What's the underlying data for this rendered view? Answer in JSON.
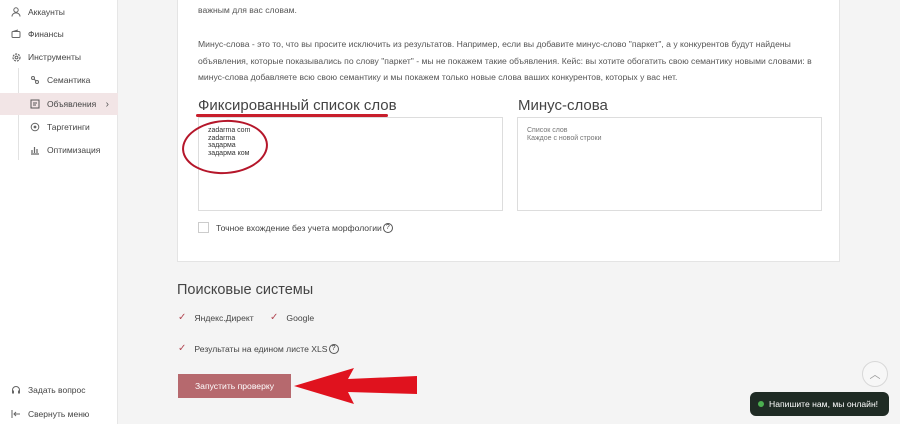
{
  "sidebar": {
    "items": [
      {
        "label": "Аккаунты",
        "icon": "user-icon"
      },
      {
        "label": "Финансы",
        "icon": "wallet-icon"
      },
      {
        "label": "Инструменты",
        "icon": "gear-icon"
      },
      {
        "label": "Семантика",
        "icon": "semantics-icon"
      },
      {
        "label": "Объявления",
        "icon": "ads-icon"
      },
      {
        "label": "Таргетинги",
        "icon": "target-icon"
      },
      {
        "label": "Оптимизация",
        "icon": "chart-icon"
      }
    ],
    "ask_question": "Задать вопрос",
    "collapse_menu": "Свернуть меню"
  },
  "main": {
    "intro_tail": "важным для вас словам.",
    "minus_description": "Минус-слова - это то, что вы просите исключить из результатов. Например, если вы добавите минус-слово \"паркет\", а у конкурентов будут найдены объявления, которые показывались по слову \"паркет\" - мы не покажем такие объявления. Кейс: вы хотите обогатить свою семантику новыми словами: в минус-слова добавляете всю свою семантику и мы покажем только новые слова ваших конкурентов, которых у вас нет.",
    "fixed_list_title": "Фиксированный список слов",
    "fixed_list_value": "zadarma com\nzadarma\nзадарма\nзадарма ком",
    "minus_words_title": "Минус-слова",
    "minus_words_placeholder": "Список слов\nКаждое с новой строки",
    "exact_match_label": "Точное вхождение без учета морфологии",
    "search_systems_title": "Поисковые системы",
    "yandex_label": "Яндекс.Директ",
    "google_label": "Google",
    "xls_label": "Результаты на едином листе XLS",
    "run_button": "Запустить проверку"
  },
  "chat": {
    "label": "Напишите нам, мы онлайн!"
  },
  "colors": {
    "accent": "#b6696e",
    "annotation_red": "#c81e2c",
    "chat_bg": "#1f2b24",
    "online": "#4caf50"
  }
}
